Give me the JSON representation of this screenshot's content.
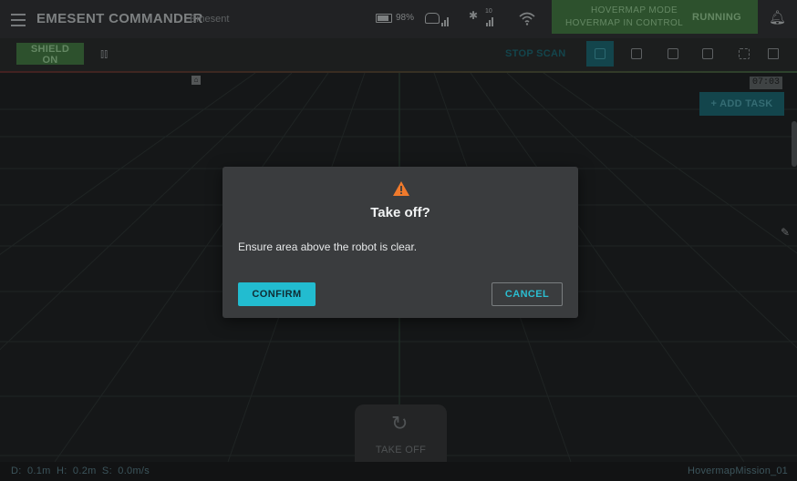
{
  "header": {
    "menu_icon": "hamburger-menu-icon",
    "app_title": "EMESENT COMMANDER",
    "app_subtitle": "Emesent",
    "battery_icon": "battery-icon",
    "battery_level": "98%",
    "controller_icon": "controller-icon",
    "satellite_icon": "satellite-icon",
    "satellite_count": "10",
    "wifi_icon": "wifi-icon",
    "mode_line1": "HOVERMAP MODE",
    "mode_line2": "HOVERMAP IN CONTROL",
    "mode_status": "RUNNING",
    "bell_icon": "bell-icon"
  },
  "toolbar": {
    "shield_label": "SHIELD ON",
    "sliders_icon": "sliders-icon",
    "stop_scan_label": "STOP SCAN",
    "view_buttons": [
      "perspective-view-icon",
      "front-view-icon",
      "side-view-icon",
      "top-view-icon",
      "focus-view-icon"
    ],
    "chat_icon": "message-icon"
  },
  "viewport": {
    "home_icon": "home-icon",
    "timer": "07:03",
    "add_task_label": "+ ADD TASK",
    "pencil_icon": "pencil-icon",
    "takeoff_icon": "takeoff-spinner-icon",
    "takeoff_label": "TAKE OFF"
  },
  "statusbar": {
    "telemetry": "D: 0.1m   H: 0.2m   S: 0.0m/s",
    "mission_name": "HovermapMission_01"
  },
  "dialog": {
    "icon": "warning-icon",
    "title": "Take off?",
    "message": "Ensure area above the robot is clear.",
    "confirm_label": "CONFIRM",
    "cancel_label": "CANCEL"
  },
  "colors": {
    "accent": "#22bcd0",
    "mode_green": "#3c6d3d",
    "warning": "#f07a2c"
  }
}
